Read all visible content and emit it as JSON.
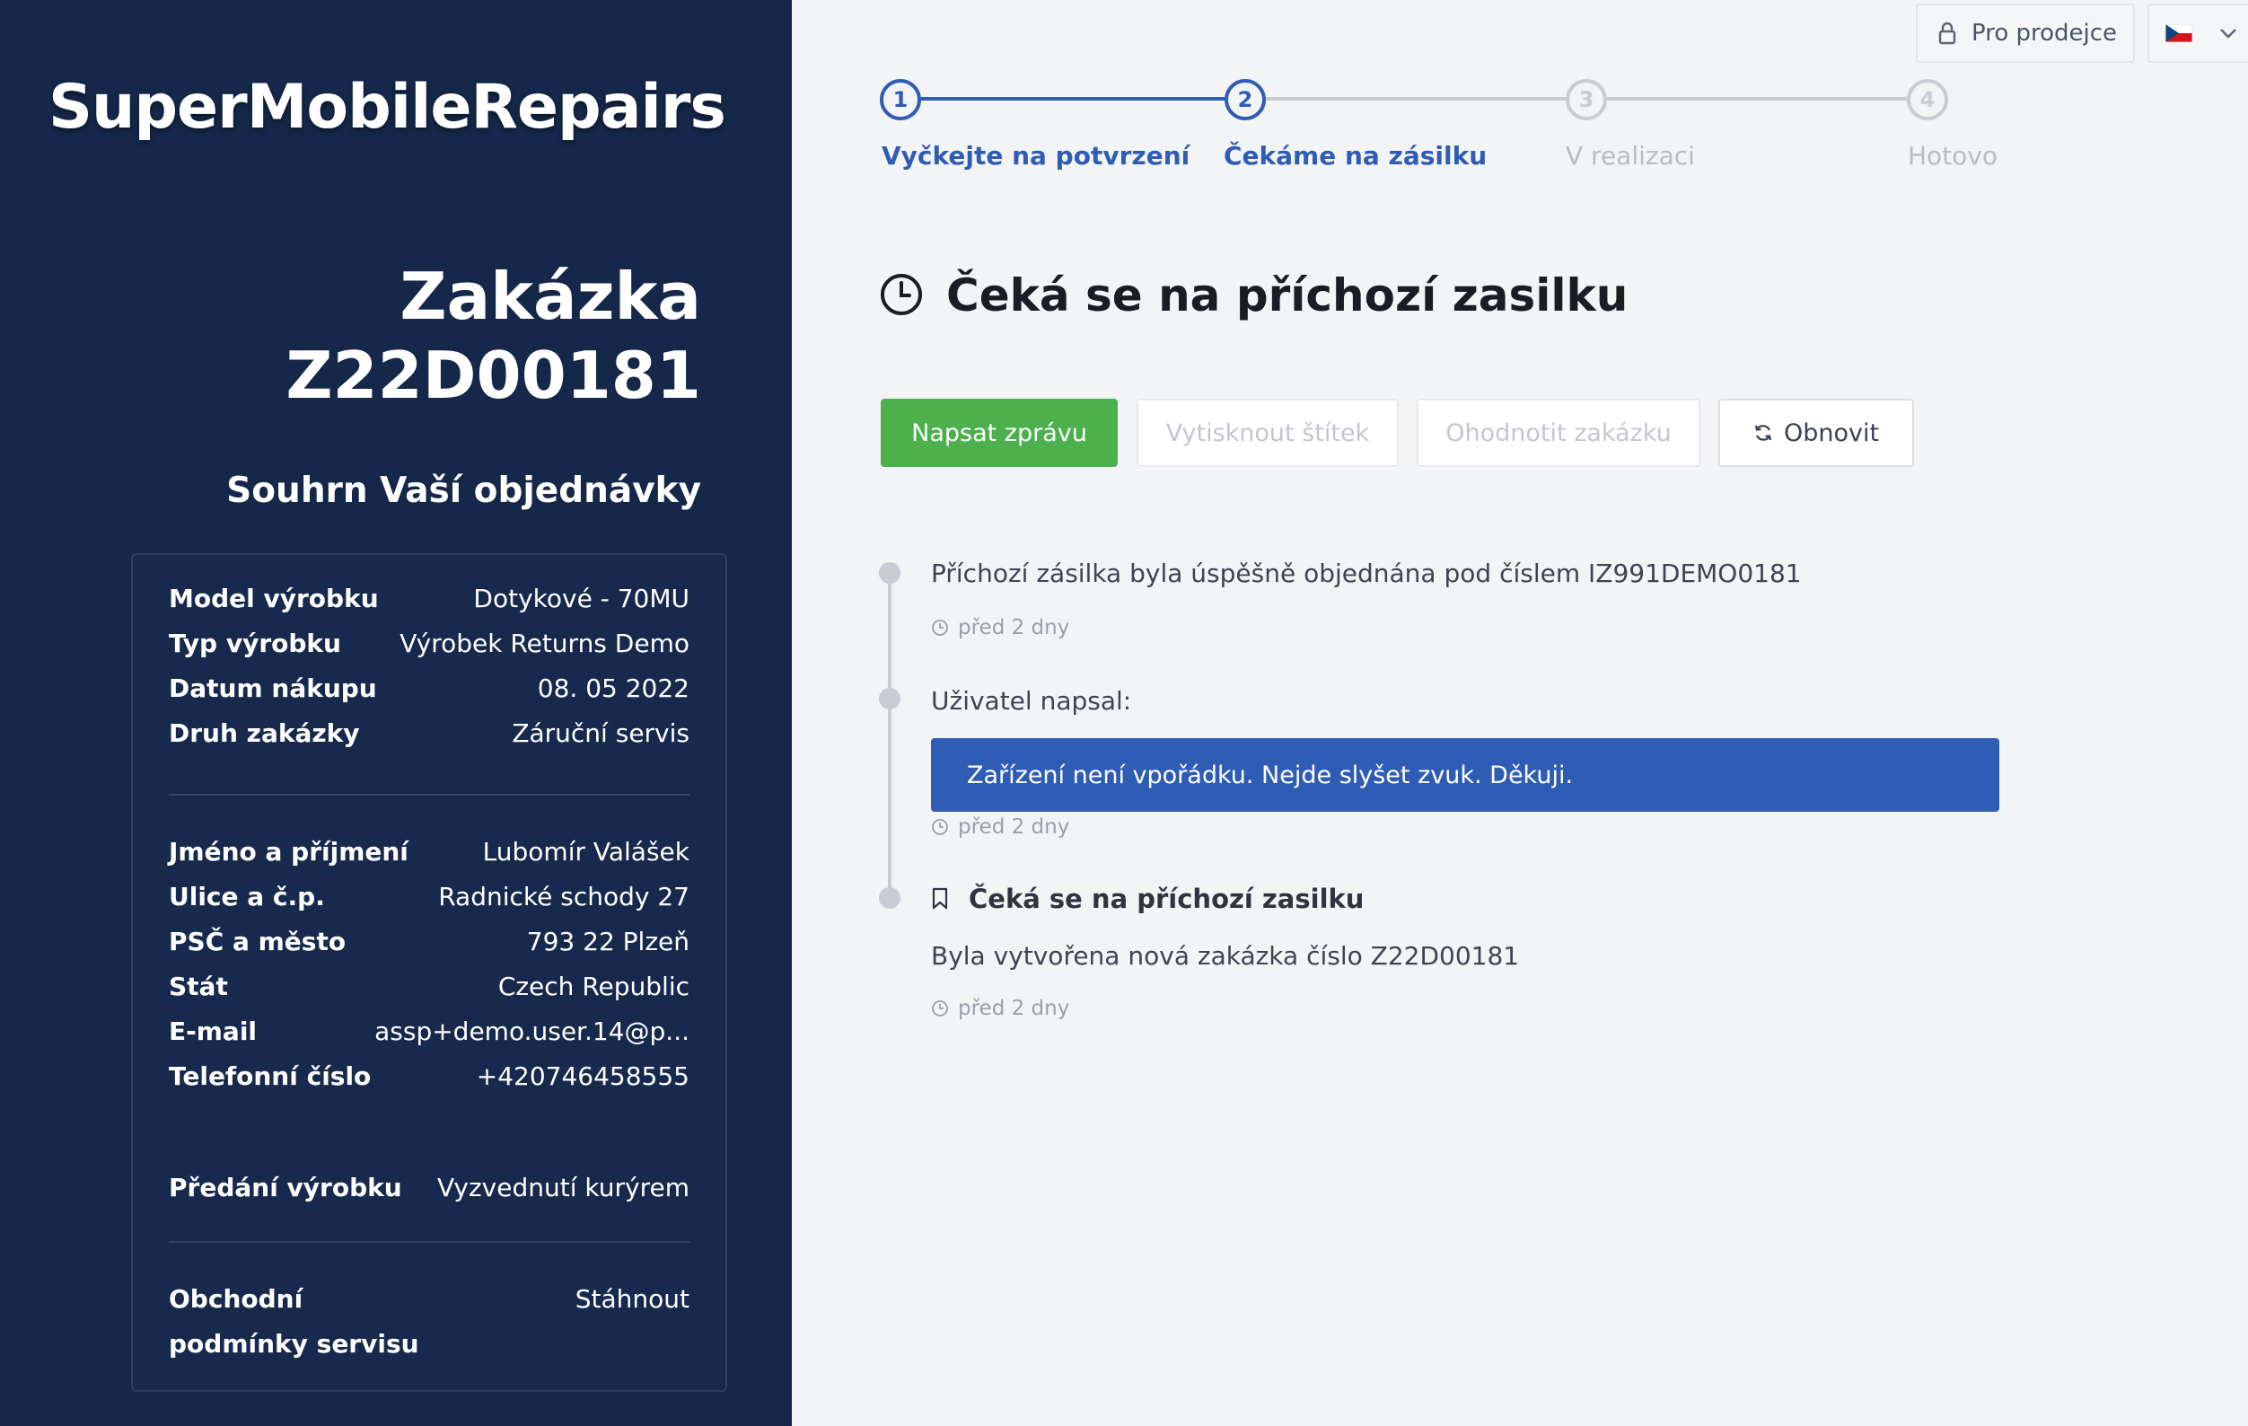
{
  "sidebar": {
    "brand": "SuperMobileRepairs",
    "order_title_line1": "Zakázka",
    "order_title_line2": "Z22D00181",
    "summary_title": "Souhrn Vaší objednávky",
    "product": [
      {
        "label": "Model výrobku",
        "value": "Dotykové - 70MU"
      },
      {
        "label": "Typ výrobku",
        "value": "Výrobek Returns Demo"
      },
      {
        "label": "Datum nákupu",
        "value": "08. 05 2022"
      },
      {
        "label": "Druh zakázky",
        "value": "Záruční servis"
      }
    ],
    "customer": [
      {
        "label": "Jméno a příjmení",
        "value": "Lubomír Valášek"
      },
      {
        "label": "Ulice a č.p.",
        "value": "Radnické schody 27"
      },
      {
        "label": "PSČ a město",
        "value": "793 22 Plzeň"
      },
      {
        "label": "Stát",
        "value": "Czech Republic"
      },
      {
        "label": "E-mail",
        "value": "assp+demo.user.14@p..."
      },
      {
        "label": "Telefonní číslo",
        "value": "+420746458555"
      }
    ],
    "handover": {
      "label": "Předání výrobku",
      "value": "Vyzvednutí kurýrem"
    },
    "terms": {
      "label": "Obchodní podmínky servisu",
      "value": "Stáhnout"
    }
  },
  "topbar": {
    "seller_label": "Pro prodejce",
    "language_icon": "czech-flag-icon"
  },
  "stepper": {
    "steps": [
      {
        "number": "1",
        "label": "Vyčkejte na potvrzení",
        "state": "done"
      },
      {
        "number": "2",
        "label": "Čekáme na zásilku",
        "state": "current"
      },
      {
        "number": "3",
        "label": "V realizaci",
        "state": "pending"
      },
      {
        "number": "4",
        "label": "Hotovo",
        "state": "pending"
      }
    ]
  },
  "status": {
    "title": "Čeká se na příchozí zasilku"
  },
  "actions": {
    "write_message": "Napsat zprávu",
    "print_label": "Vytisknout štítek",
    "rate_order": "Ohodnotit zakázku",
    "refresh": "Obnovit"
  },
  "timeline": [
    {
      "text": "Příchozí zásilka byla úspěšně objednána pod číslem IZ991DEMO0181",
      "time": "před 2 dny"
    },
    {
      "text": "Uživatel napsal:",
      "message": "Zařízení není vpořádku. Nejde slyšet zvuk. Děkuji.",
      "time": "před 2 dny"
    },
    {
      "title": "Čeká se na příchozí zasilku",
      "text": "Byla vytvořena nová zakázka číslo Z22D00181",
      "time": "před 2 dny"
    }
  ],
  "colors": {
    "sidebar_bg": "#15284a",
    "accent_blue": "#2f5cb5",
    "green": "#4cb04d"
  }
}
